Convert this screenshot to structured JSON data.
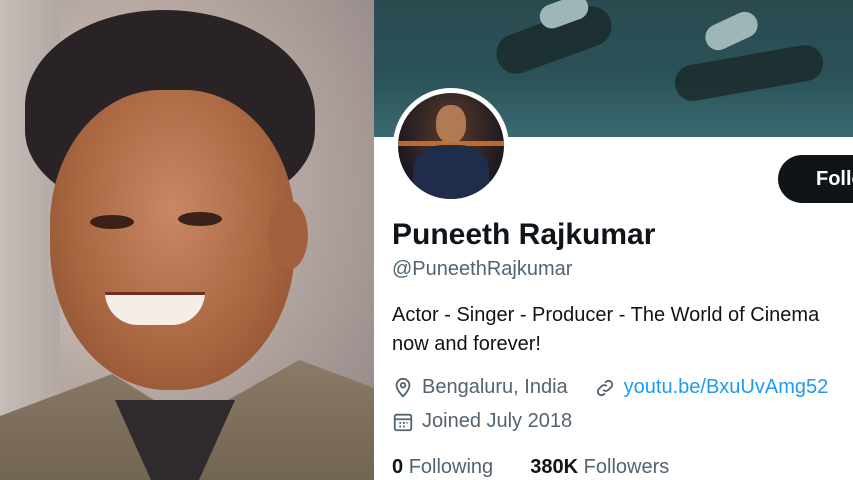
{
  "profile": {
    "name": "Puneeth Rajkumar",
    "handle": "@PuneethRajkumar",
    "bio_line1": "Actor - Singer - Producer - The World of Cinema",
    "bio_line2": "now and forever!",
    "location": "Bengaluru, India",
    "website": "youtu.be/BxuUvAmg52",
    "joined": "Joined July 2018",
    "following_count": "0",
    "following_label": "Following",
    "followers_count": "380K",
    "followers_label": "Followers"
  },
  "actions": {
    "follow_label": "Follow"
  },
  "icons": {
    "location": "location-pin-icon",
    "link": "link-icon",
    "calendar": "calendar-icon"
  },
  "colors": {
    "accent": "#1d9bf0",
    "text_primary": "#0f1419",
    "text_secondary": "#536471",
    "button_bg": "#0f1419"
  }
}
